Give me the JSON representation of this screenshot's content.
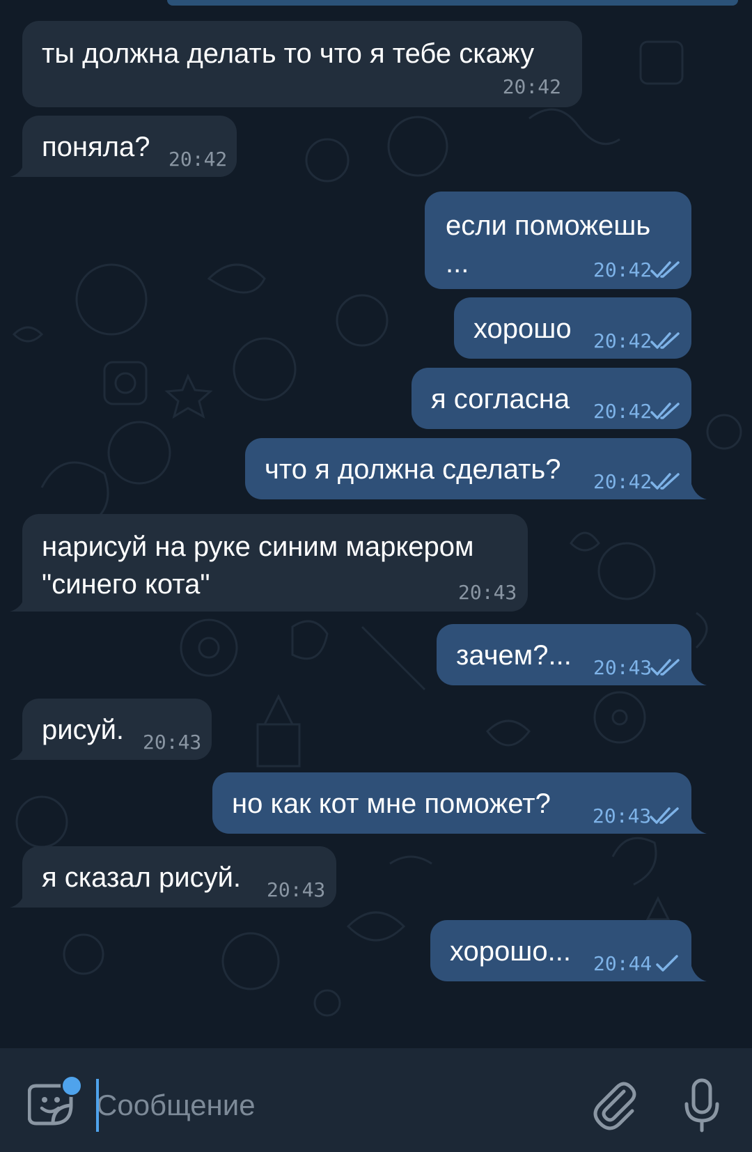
{
  "messages": [
    {
      "direction": "in",
      "text": "ты должна делать то что я тебе скажу",
      "time": "20:42"
    },
    {
      "direction": "in",
      "text": "поняла?",
      "time": "20:42"
    },
    {
      "direction": "out",
      "text": "если поможешь\n...",
      "time": "20:42",
      "status": "read"
    },
    {
      "direction": "out",
      "text": "хорошо",
      "time": "20:42",
      "status": "read"
    },
    {
      "direction": "out",
      "text": "я согласна",
      "time": "20:42",
      "status": "read"
    },
    {
      "direction": "out",
      "text": "что я должна сделать?",
      "time": "20:42",
      "status": "read"
    },
    {
      "direction": "in",
      "text": "нарисуй на руке синим маркером\n\"синего кота\"",
      "time": "20:43"
    },
    {
      "direction": "out",
      "text": "зачем?...",
      "time": "20:43",
      "status": "read"
    },
    {
      "direction": "in",
      "text": "рисуй.",
      "time": "20:43"
    },
    {
      "direction": "out",
      "text": "но как кот мне поможет?",
      "time": "20:43",
      "status": "read"
    },
    {
      "direction": "in",
      "text": "я сказал рисуй.",
      "time": "20:43"
    },
    {
      "direction": "out",
      "text": "хорошо...",
      "time": "20:44",
      "status": "sent"
    }
  ],
  "composer": {
    "placeholder": "Сообщение",
    "emoji_icon": "sticker-emoji-icon",
    "attach_icon": "paperclip-icon",
    "mic_icon": "microphone-icon"
  },
  "colors": {
    "background": "#111b27",
    "incoming_bubble": "#222e3c",
    "outgoing_bubble": "#2f5078",
    "outgoing_time": "#7eb3e8",
    "incoming_time": "#8a96a3",
    "composer_bg": "#1c2836",
    "accent": "#4fa3ec"
  }
}
